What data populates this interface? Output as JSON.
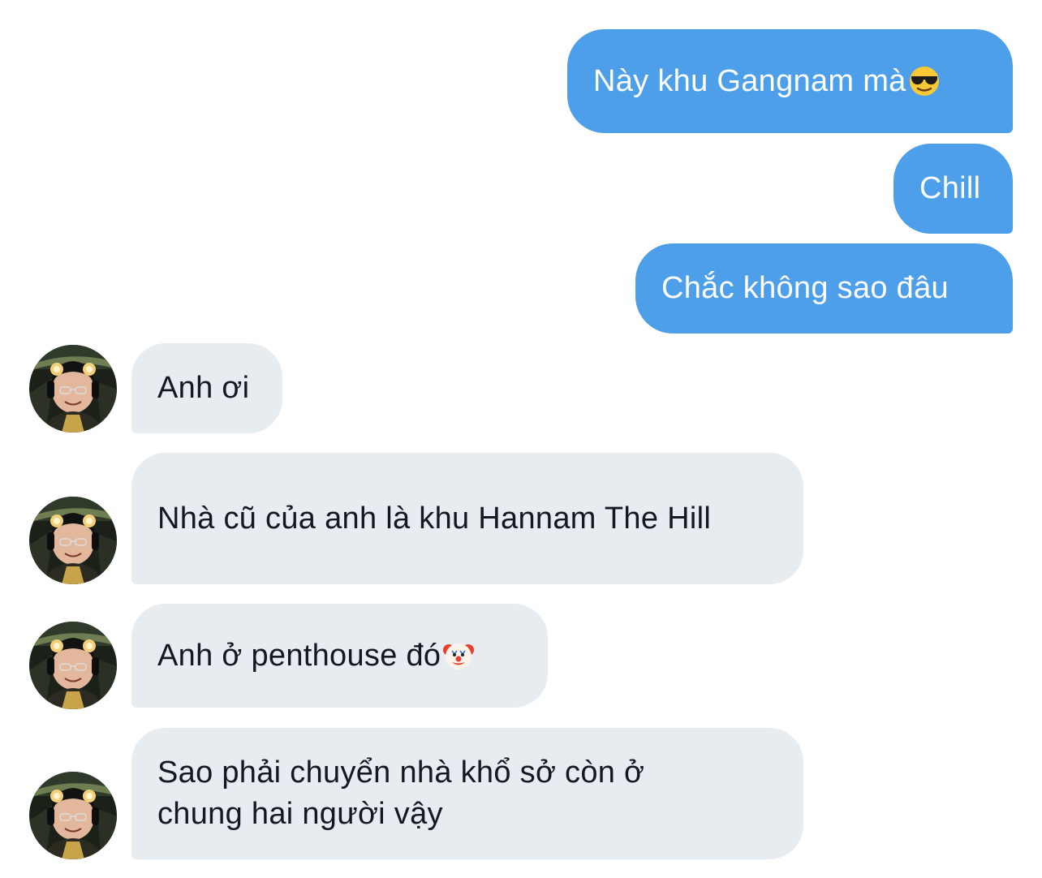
{
  "conversation": {
    "sent": [
      {
        "text": "Này khu Gangnam mà",
        "emoji": "smiling-face-with-sunglasses-emoji"
      },
      {
        "text": "Chill"
      },
      {
        "text": "Chắc không sao đâu"
      }
    ],
    "received": [
      {
        "text": "Anh ơi"
      },
      {
        "text": "Nhà cũ của anh là khu Hannam The Hill"
      },
      {
        "text": "Anh ở penthouse đó",
        "emoji": "clown-face-emoji"
      },
      {
        "text": "Sao phải chuyển nhà khổ sở còn ở chung hai người vậy"
      }
    ]
  },
  "colors": {
    "sent_bubble": "#4e9fe9",
    "received_bubble": "#e7ecf1",
    "received_text": "#141823"
  }
}
